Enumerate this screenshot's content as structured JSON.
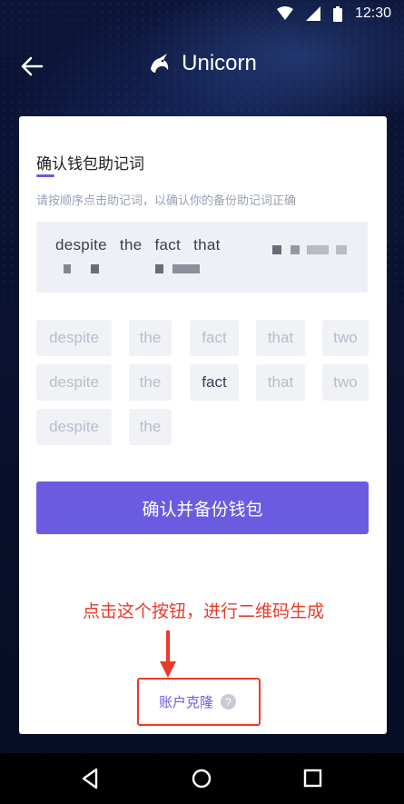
{
  "status_bar": {
    "time": "12:30",
    "icons": [
      "wifi-icon",
      "signal-icon",
      "battery-icon"
    ]
  },
  "header": {
    "back_icon": "arrow-left-icon",
    "logo_icon": "unicorn-logo-icon",
    "title": "Unicorn"
  },
  "card": {
    "title": "确认钱包助记词",
    "subtitle": "请按顺序点击助记词，以确认你的备份助记词正确",
    "selected_words": [
      "despite",
      "the",
      "fact",
      "that"
    ],
    "word_buttons": [
      "despite",
      "the",
      "fact",
      "that",
      "two",
      "despite",
      "the",
      "fact",
      "that",
      "two",
      "despite",
      "the"
    ],
    "confirm_button": "确认并备份钱包",
    "clone_link": "账户克隆",
    "help_icon_glyph": "?"
  },
  "annotation": {
    "text": "点击这个按钮，进行二维码生成",
    "color": "#ea3a2a"
  },
  "nav_bar": {
    "icons": [
      "back-triangle-icon",
      "home-circle-icon",
      "recents-square-icon"
    ]
  },
  "colors": {
    "accent": "#6a5be0",
    "background": "#0b1230",
    "annotation_red": "#ea3a2a"
  }
}
